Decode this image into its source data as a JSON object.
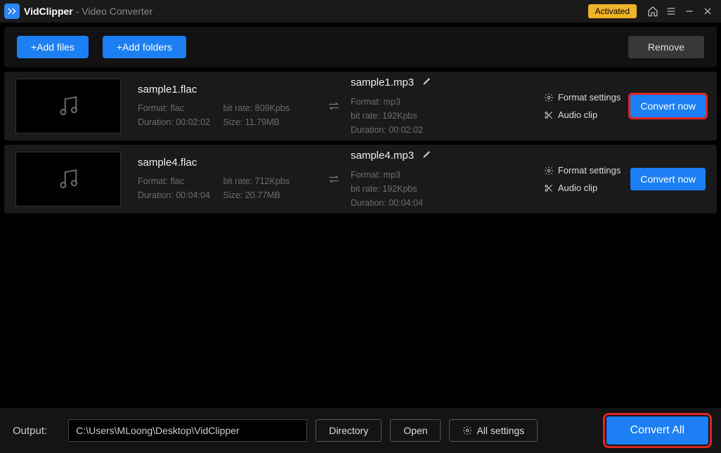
{
  "titlebar": {
    "app_name": "VidClipper",
    "app_sub": "- Video Converter",
    "activated_label": "Activated"
  },
  "toolbar": {
    "add_files_label": "+Add files",
    "add_folders_label": "+Add folders",
    "remove_label": "Remove"
  },
  "files": [
    {
      "src_name": "sample1.flac",
      "src_format": "Format: flac",
      "src_bitrate": "bit rate: 809Kpbs",
      "src_duration": "Duration: 00:02:02",
      "src_size": "Size: 11.79MB",
      "dst_name": "sample1.mp3",
      "dst_format": "Format: mp3",
      "dst_bitrate": "bit rate: 192Kpbs",
      "dst_duration": "Duration: 00:02:02",
      "highlighted": true
    },
    {
      "src_name": "sample4.flac",
      "src_format": "Format: flac",
      "src_bitrate": "bit rate: 712Kpbs",
      "src_duration": "Duration: 00:04:04",
      "src_size": "Size: 20.77MB",
      "dst_name": "sample4.mp3",
      "dst_format": "Format: mp3",
      "dst_bitrate": "bit rate: 192Kpbs",
      "dst_duration": "Duration: 00:04:04",
      "highlighted": false
    }
  ],
  "actions": {
    "format_settings_label": "Format settings",
    "audio_clip_label": "Audio clip",
    "convert_now_label": "Convert now"
  },
  "bottombar": {
    "output_label": "Output:",
    "output_path": "C:\\Users\\MLoong\\Desktop\\VidClipper",
    "directory_label": "Directory",
    "open_label": "Open",
    "all_settings_label": "All settings",
    "convert_all_label": "Convert All"
  }
}
